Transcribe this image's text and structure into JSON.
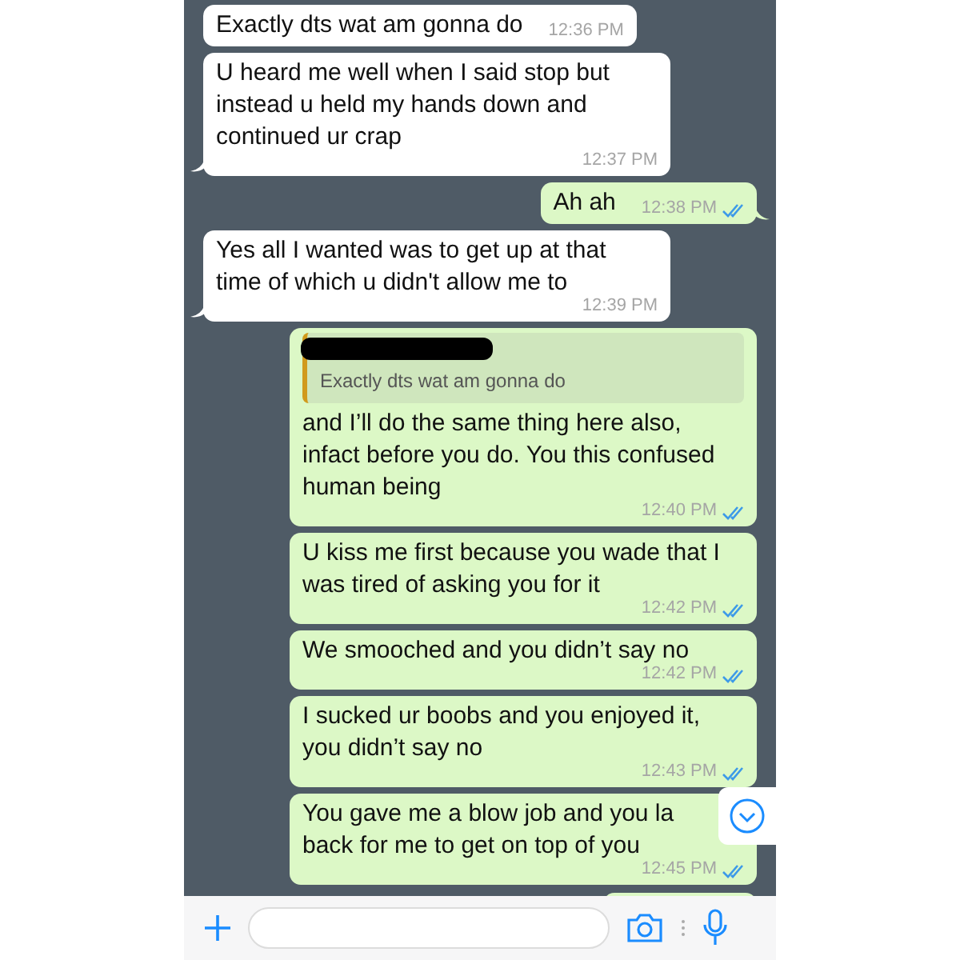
{
  "messages": [
    {
      "kind": "incoming",
      "text": "Exactly dts wat am gonna do",
      "time": "12:36 PM",
      "tail": false
    },
    {
      "kind": "incoming",
      "text": "U heard me well when I said stop but instead u held my hands down and continued ur crap",
      "time": "12:37 PM",
      "tail": true
    },
    {
      "kind": "outgoing",
      "text": "Ah ah",
      "time": "12:38 PM",
      "read": true,
      "tail": true
    },
    {
      "kind": "incoming",
      "text": "Yes all I wanted was to get up at that time of which u didn't allow me to",
      "time": "12:39 PM",
      "tail": true
    },
    {
      "kind": "outgoing",
      "quote": {
        "text": "Exactly dts wat am gonna do"
      },
      "text": "and I’ll do the same thing here also, infact before you do. You this confused human being",
      "time": "12:40 PM",
      "read": true,
      "tail": false
    },
    {
      "kind": "outgoing",
      "text": "U kiss me first because you wade that I was tired of asking you for it",
      "time": "12:42 PM",
      "read": true,
      "tail": false
    },
    {
      "kind": "outgoing",
      "text": "We smooched and you didn’t say no",
      "time": "12:42 PM",
      "read": true,
      "tail": false
    },
    {
      "kind": "outgoing",
      "text": "I sucked ur boobs and you enjoyed it, you didn’t say no",
      "time": "12:43 PM",
      "read": true,
      "tail": false
    },
    {
      "kind": "outgoing",
      "text": "You gave me a blow job and you la\nback for me to get on top of you",
      "time": "12:45 PM",
      "read": true,
      "tail": false
    },
    {
      "kind": "outgoing"
    }
  ]
}
